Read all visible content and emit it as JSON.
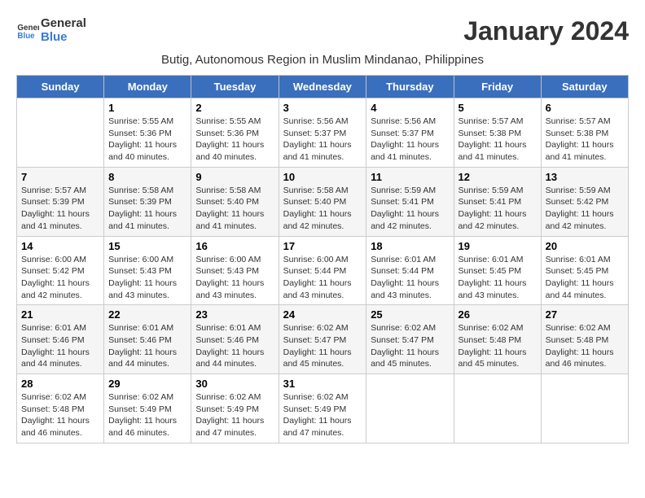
{
  "header": {
    "logo_line1": "General",
    "logo_line2": "Blue",
    "month_title": "January 2024",
    "subtitle": "Butig, Autonomous Region in Muslim Mindanao, Philippines"
  },
  "days_of_week": [
    "Sunday",
    "Monday",
    "Tuesday",
    "Wednesday",
    "Thursday",
    "Friday",
    "Saturday"
  ],
  "weeks": [
    [
      {
        "day": "",
        "info": ""
      },
      {
        "day": "1",
        "info": "Sunrise: 5:55 AM\nSunset: 5:36 PM\nDaylight: 11 hours\nand 40 minutes."
      },
      {
        "day": "2",
        "info": "Sunrise: 5:55 AM\nSunset: 5:36 PM\nDaylight: 11 hours\nand 40 minutes."
      },
      {
        "day": "3",
        "info": "Sunrise: 5:56 AM\nSunset: 5:37 PM\nDaylight: 11 hours\nand 41 minutes."
      },
      {
        "day": "4",
        "info": "Sunrise: 5:56 AM\nSunset: 5:37 PM\nDaylight: 11 hours\nand 41 minutes."
      },
      {
        "day": "5",
        "info": "Sunrise: 5:57 AM\nSunset: 5:38 PM\nDaylight: 11 hours\nand 41 minutes."
      },
      {
        "day": "6",
        "info": "Sunrise: 5:57 AM\nSunset: 5:38 PM\nDaylight: 11 hours\nand 41 minutes."
      }
    ],
    [
      {
        "day": "7",
        "info": "Sunrise: 5:57 AM\nSunset: 5:39 PM\nDaylight: 11 hours\nand 41 minutes."
      },
      {
        "day": "8",
        "info": "Sunrise: 5:58 AM\nSunset: 5:39 PM\nDaylight: 11 hours\nand 41 minutes."
      },
      {
        "day": "9",
        "info": "Sunrise: 5:58 AM\nSunset: 5:40 PM\nDaylight: 11 hours\nand 41 minutes."
      },
      {
        "day": "10",
        "info": "Sunrise: 5:58 AM\nSunset: 5:40 PM\nDaylight: 11 hours\nand 42 minutes."
      },
      {
        "day": "11",
        "info": "Sunrise: 5:59 AM\nSunset: 5:41 PM\nDaylight: 11 hours\nand 42 minutes."
      },
      {
        "day": "12",
        "info": "Sunrise: 5:59 AM\nSunset: 5:41 PM\nDaylight: 11 hours\nand 42 minutes."
      },
      {
        "day": "13",
        "info": "Sunrise: 5:59 AM\nSunset: 5:42 PM\nDaylight: 11 hours\nand 42 minutes."
      }
    ],
    [
      {
        "day": "14",
        "info": "Sunrise: 6:00 AM\nSunset: 5:42 PM\nDaylight: 11 hours\nand 42 minutes."
      },
      {
        "day": "15",
        "info": "Sunrise: 6:00 AM\nSunset: 5:43 PM\nDaylight: 11 hours\nand 43 minutes."
      },
      {
        "day": "16",
        "info": "Sunrise: 6:00 AM\nSunset: 5:43 PM\nDaylight: 11 hours\nand 43 minutes."
      },
      {
        "day": "17",
        "info": "Sunrise: 6:00 AM\nSunset: 5:44 PM\nDaylight: 11 hours\nand 43 minutes."
      },
      {
        "day": "18",
        "info": "Sunrise: 6:01 AM\nSunset: 5:44 PM\nDaylight: 11 hours\nand 43 minutes."
      },
      {
        "day": "19",
        "info": "Sunrise: 6:01 AM\nSunset: 5:45 PM\nDaylight: 11 hours\nand 43 minutes."
      },
      {
        "day": "20",
        "info": "Sunrise: 6:01 AM\nSunset: 5:45 PM\nDaylight: 11 hours\nand 44 minutes."
      }
    ],
    [
      {
        "day": "21",
        "info": "Sunrise: 6:01 AM\nSunset: 5:46 PM\nDaylight: 11 hours\nand 44 minutes."
      },
      {
        "day": "22",
        "info": "Sunrise: 6:01 AM\nSunset: 5:46 PM\nDaylight: 11 hours\nand 44 minutes."
      },
      {
        "day": "23",
        "info": "Sunrise: 6:01 AM\nSunset: 5:46 PM\nDaylight: 11 hours\nand 44 minutes."
      },
      {
        "day": "24",
        "info": "Sunrise: 6:02 AM\nSunset: 5:47 PM\nDaylight: 11 hours\nand 45 minutes."
      },
      {
        "day": "25",
        "info": "Sunrise: 6:02 AM\nSunset: 5:47 PM\nDaylight: 11 hours\nand 45 minutes."
      },
      {
        "day": "26",
        "info": "Sunrise: 6:02 AM\nSunset: 5:48 PM\nDaylight: 11 hours\nand 45 minutes."
      },
      {
        "day": "27",
        "info": "Sunrise: 6:02 AM\nSunset: 5:48 PM\nDaylight: 11 hours\nand 46 minutes."
      }
    ],
    [
      {
        "day": "28",
        "info": "Sunrise: 6:02 AM\nSunset: 5:48 PM\nDaylight: 11 hours\nand 46 minutes."
      },
      {
        "day": "29",
        "info": "Sunrise: 6:02 AM\nSunset: 5:49 PM\nDaylight: 11 hours\nand 46 minutes."
      },
      {
        "day": "30",
        "info": "Sunrise: 6:02 AM\nSunset: 5:49 PM\nDaylight: 11 hours\nand 47 minutes."
      },
      {
        "day": "31",
        "info": "Sunrise: 6:02 AM\nSunset: 5:49 PM\nDaylight: 11 hours\nand 47 minutes."
      },
      {
        "day": "",
        "info": ""
      },
      {
        "day": "",
        "info": ""
      },
      {
        "day": "",
        "info": ""
      }
    ]
  ]
}
